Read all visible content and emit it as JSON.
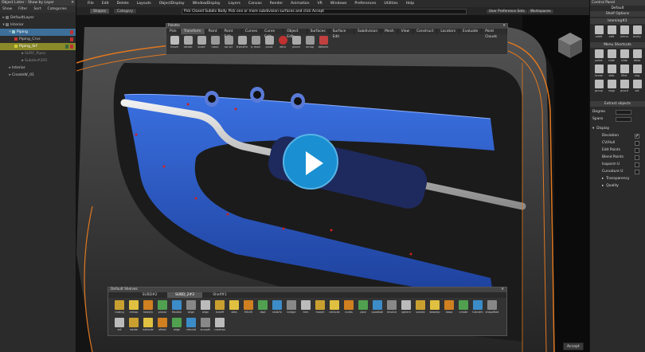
{
  "lister": {
    "title": "Object Lister : Show by Layer",
    "menu": [
      "Show",
      "Filter",
      "Sort",
      "Categories"
    ],
    "items": [
      {
        "label": "DefaultLayer",
        "style": "normal"
      },
      {
        "label": "Interior",
        "style": "normal"
      },
      {
        "label": "Piping",
        "style": "blue"
      },
      {
        "label": "Piping_Crvs",
        "style": "normal"
      },
      {
        "label": "Piping_Srf",
        "style": "yellow"
      },
      {
        "label": "SURF_Pipes",
        "style": "dim"
      },
      {
        "label": "Subdiv#205",
        "style": "dim"
      },
      {
        "label": "Interior",
        "style": "normal"
      },
      {
        "label": "CreateW_01",
        "style": "normal"
      }
    ]
  },
  "menubar": [
    "File",
    "Edit",
    "Delete",
    "Layouts",
    "ObjectDisplay",
    "WindowDisplay",
    "Layers",
    "Canvas",
    "Render",
    "Animation",
    "VR",
    "Windows",
    "Preferences",
    "Utilities",
    "Help"
  ],
  "toolbar": {
    "tabs": [
      "Shapes",
      "Category"
    ]
  },
  "prompt": "Pick Closed Subdiv Body. Pick one or more subdivision surfaces and click Accept",
  "pref_sets": "User Preference Sets",
  "workspaces": "Workspaces",
  "palette": {
    "title": "Palette",
    "tabs": [
      "Pick",
      "Transform",
      "Paint",
      "Paint Edit",
      "Curves",
      "Curve Edit",
      "Object Edit",
      "Surfaces",
      "Surface Edit",
      "Subdivision",
      "Mesh",
      "View",
      "Construct",
      "Locators",
      "Evaluate",
      "Point Clouds"
    ],
    "active_tab": "Transform",
    "tools": [
      "move",
      "rotate",
      "scale",
      "nonp",
      "sp scl",
      "transfm",
      "p mod",
      "pivot",
      "zero",
      "place",
      "xmap",
      "deform"
    ]
  },
  "right_panel": {
    "title": "Control Panel",
    "default_label": "Default",
    "shelf_options": "Shelf Options",
    "learning": "learning#2",
    "learning_tools": [
      "addlt",
      "edit",
      "mirror",
      "bndry"
    ],
    "menu_shortcuts": "Menu Shortcuts",
    "shortcuts": [
      "pellet",
      "slide",
      "slide",
      "disks",
      "break",
      "slab",
      "fillet",
      "ring",
      "group",
      "regp",
      "grpcd",
      "sdl"
    ],
    "extract_header": "Extract objects",
    "degree_label": "Degree",
    "spans_label": "Spans",
    "display_header": "Display",
    "options": [
      {
        "label": "Deviation",
        "checked": true
      },
      {
        "label": "CV/Hull",
        "checked": false
      },
      {
        "label": "Edit Points",
        "checked": false
      },
      {
        "label": "Blend Points",
        "checked": false
      },
      {
        "label": "Isoparm U",
        "checked": false
      },
      {
        "label": "Curvature U",
        "checked": false
      }
    ],
    "sub": [
      "Transparency",
      "Quality"
    ]
  },
  "shelves": {
    "title": "Default Shelves",
    "tabs": [
      "SUBD#2",
      "SUBD_2#3",
      "Shelf#1"
    ],
    "active_tab": "SUBD_2#3",
    "tools": [
      "nosing",
      "remap",
      "heavily",
      "planar",
      "flexible",
      "align",
      "align",
      "tubeff",
      "dots",
      "fillt-fill",
      "dspl",
      "radsrfx",
      "bridge",
      "trim",
      "morph",
      "extrude",
      "nurbs",
      "pipe",
      "quadball",
      "revolve",
      "sphere",
      "subdiv",
      "bsweep",
      "lasso",
      "create",
      "transfm",
      "shapeftail",
      "sdl",
      "rotate",
      "extrude",
      "offset",
      "align",
      "rebuild",
      "smooth",
      "creation"
    ]
  },
  "accept_label": "Accept",
  "colors": {
    "accent": "#1a8fd1",
    "wire": "#e07820",
    "blue_srf": "#2a5fd0"
  }
}
